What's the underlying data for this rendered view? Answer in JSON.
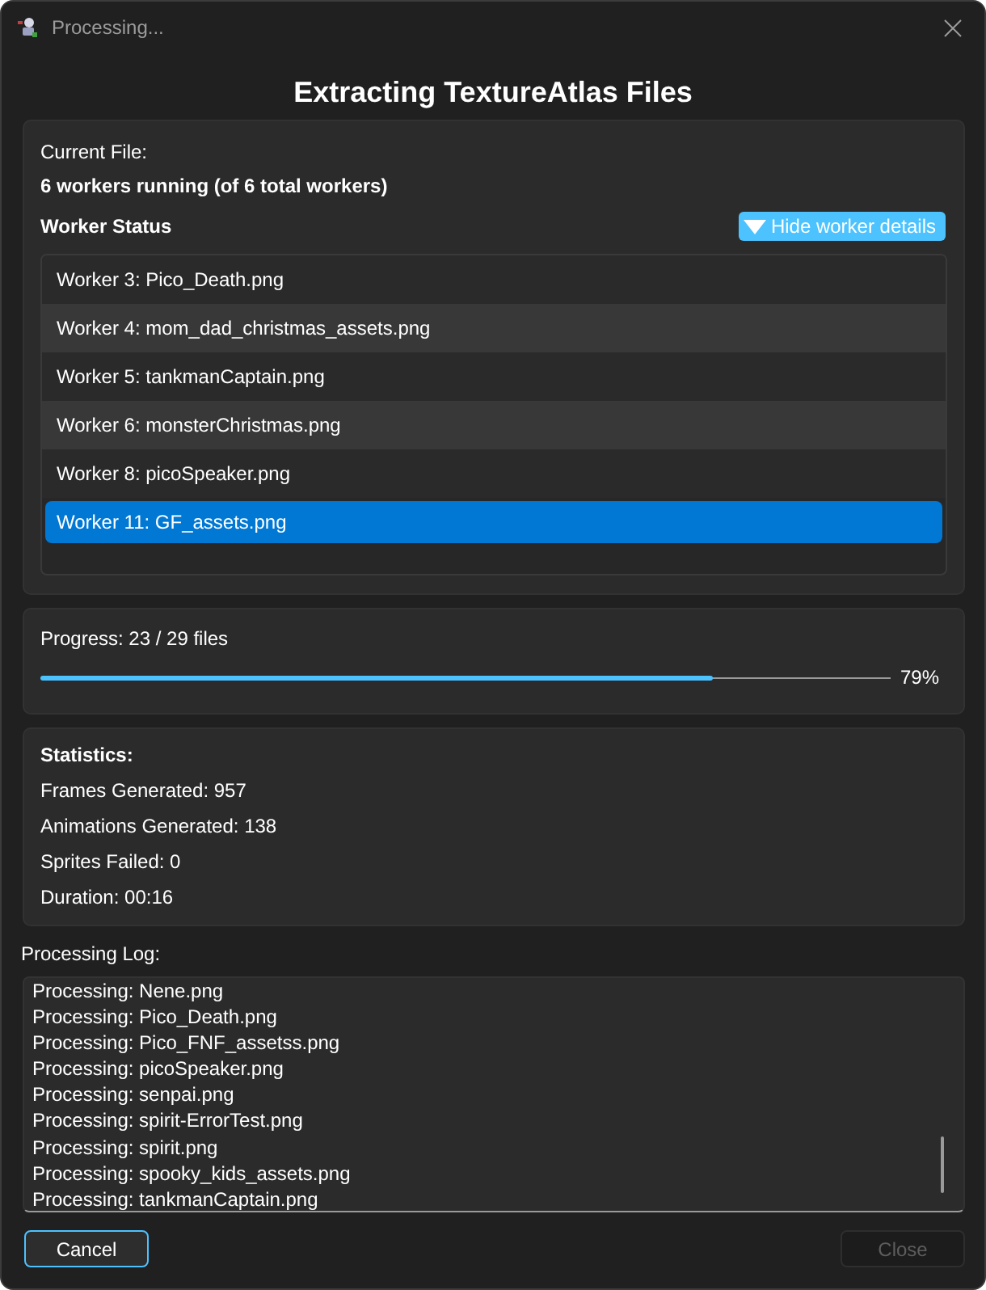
{
  "window": {
    "title": "Processing..."
  },
  "heading": "Extracting TextureAtlas Files",
  "worker_panel": {
    "current_file_label": "Current File:",
    "workers_summary": "6 workers running (of 6 total workers)",
    "section_title": "Worker Status",
    "toggle_button": "Hide worker details",
    "workers": [
      {
        "label": "Worker 3: Pico_Death.png",
        "selected": false
      },
      {
        "label": "Worker 4: mom_dad_christmas_assets.png",
        "selected": false
      },
      {
        "label": "Worker 5: tankmanCaptain.png",
        "selected": false
      },
      {
        "label": "Worker 6: monsterChristmas.png",
        "selected": false
      },
      {
        "label": "Worker 8: picoSpeaker.png",
        "selected": false
      },
      {
        "label": "Worker 11: GF_assets.png",
        "selected": true
      }
    ]
  },
  "progress": {
    "label": "Progress: 23 / 29 files",
    "level": 0.79,
    "reading": "79%"
  },
  "statistics": {
    "title": "Statistics:",
    "lines": [
      "Frames Generated: 957",
      "Animations Generated: 138",
      "Sprites Failed: 0",
      "Duration: 00:16"
    ]
  },
  "log": {
    "label": "Processing Log:",
    "lines": [
      "Processing: Nene.png",
      "Processing: Pico_Death.png",
      "Processing: Pico_FNF_assetss.png",
      "Processing: picoSpeaker.png",
      "Processing: senpai.png",
      "Processing: spirit-ErrorTest.png",
      "Processing: spirit.png",
      "Processing: spooky_kids_assets.png",
      "Processing: tankmanCaptain.png"
    ]
  },
  "buttons": [
    {
      "label": "Cancel",
      "focused": true,
      "disabled": false
    },
    {
      "label": "Close",
      "focused": false,
      "disabled": true
    }
  ]
}
